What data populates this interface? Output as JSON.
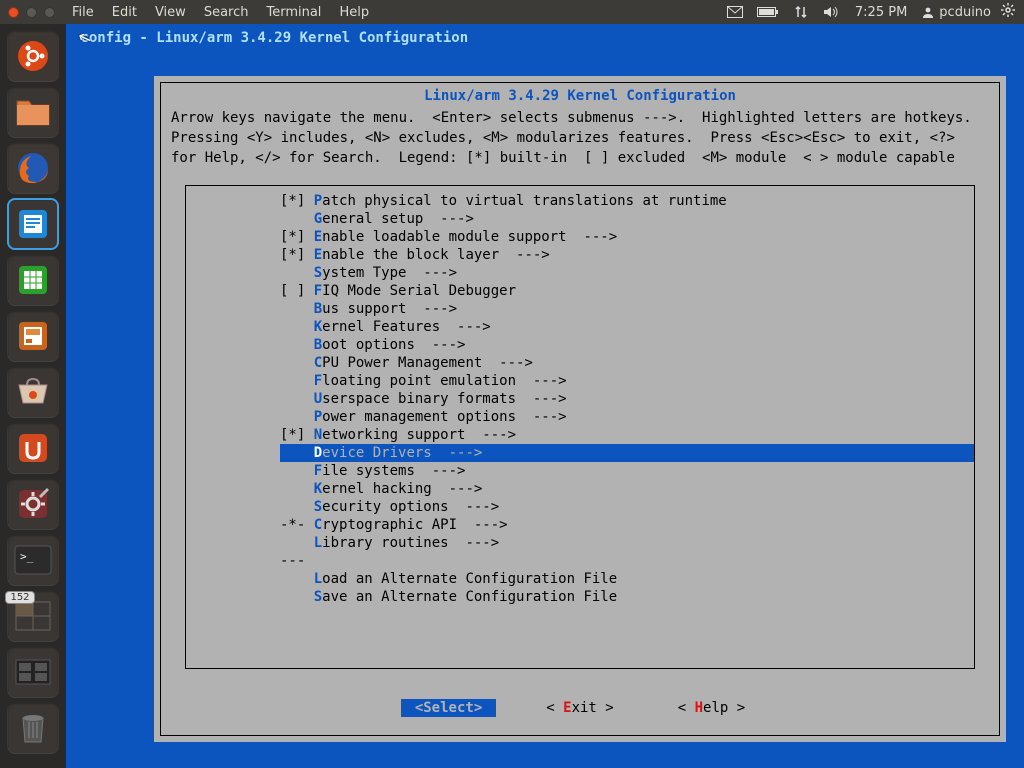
{
  "menubar": {
    "items": [
      "File",
      "Edit",
      "View",
      "Search",
      "Terminal",
      "Help"
    ],
    "clock": "7:25 PM",
    "user": "pcduino"
  },
  "launcher": {
    "badge": "152"
  },
  "terminal": {
    "title": " config - Linux/arm 3.4.29 Kernel Configuration"
  },
  "dialog": {
    "title": "Linux/arm 3.4.29 Kernel Configuration",
    "help1": "Arrow keys navigate the menu.  <Enter> selects submenus --->.  Highlighted letters are hotkeys.",
    "help2": "Pressing <Y> includes, <N> excludes, <M> modularizes features.  Press <Esc><Esc> to exit, <?>",
    "help3": "for Help, </> for Search.  Legend: [*] built-in  [ ] excluded  <M> module  < > module capable"
  },
  "menu": [
    {
      "prefix": "[*] ",
      "hot": "P",
      "rest": "atch physical to virtual translations at runtime",
      "sel": false
    },
    {
      "prefix": "    ",
      "hot": "G",
      "rest": "eneral setup  --->",
      "sel": false
    },
    {
      "prefix": "[*] ",
      "hot": "E",
      "rest": "nable loadable module support  --->",
      "sel": false
    },
    {
      "prefix": "[*] ",
      "hot": "E",
      "rest": "nable the block layer  --->",
      "sel": false
    },
    {
      "prefix": "    ",
      "hot": "S",
      "rest": "ystem Type  --->",
      "sel": false
    },
    {
      "prefix": "[ ] ",
      "hot": "F",
      "rest": "IQ Mode Serial Debugger",
      "sel": false
    },
    {
      "prefix": "    ",
      "hot": "B",
      "rest": "us support  --->",
      "sel": false
    },
    {
      "prefix": "    ",
      "hot": "K",
      "rest": "ernel Features  --->",
      "sel": false
    },
    {
      "prefix": "    ",
      "hot": "B",
      "rest": "oot options  --->",
      "sel": false
    },
    {
      "prefix": "    ",
      "hot": "C",
      "rest": "PU Power Management  --->",
      "sel": false
    },
    {
      "prefix": "    ",
      "hot": "F",
      "rest": "loating point emulation  --->",
      "sel": false
    },
    {
      "prefix": "    ",
      "hot": "U",
      "rest": "serspace binary formats  --->",
      "sel": false
    },
    {
      "prefix": "    ",
      "hot": "P",
      "rest": "ower management options  --->",
      "sel": false
    },
    {
      "prefix": "[*] ",
      "hot": "N",
      "rest": "etworking support  --->",
      "sel": false
    },
    {
      "prefix": "    ",
      "hot": "D",
      "rest": "evice Drivers  --->",
      "sel": true
    },
    {
      "prefix": "    ",
      "hot": "F",
      "rest": "ile systems  --->",
      "sel": false
    },
    {
      "prefix": "    ",
      "hot": "K",
      "rest": "ernel hacking  --->",
      "sel": false
    },
    {
      "prefix": "    ",
      "hot": "S",
      "rest": "ecurity options  --->",
      "sel": false
    },
    {
      "prefix": "-*- ",
      "hot": "C",
      "rest": "ryptographic API  --->",
      "sel": false
    },
    {
      "prefix": "    ",
      "hot": "L",
      "rest": "ibrary routines  --->",
      "sel": false
    },
    {
      "prefix": "--- ",
      "hot": "",
      "rest": "",
      "sel": false
    },
    {
      "prefix": "    ",
      "hot": "L",
      "rest": "oad an Alternate Configuration File",
      "sel": false
    },
    {
      "prefix": "    ",
      "hot": "S",
      "rest": "ave an Alternate Configuration File",
      "sel": false
    }
  ],
  "buttons": {
    "select_l": "<",
    "select": "Select",
    "select_r": ">",
    "exit_l": "< ",
    "exit_hot": "E",
    "exit": "xit >",
    "help_l": "< ",
    "help_hot": "H",
    "help": "elp >"
  }
}
